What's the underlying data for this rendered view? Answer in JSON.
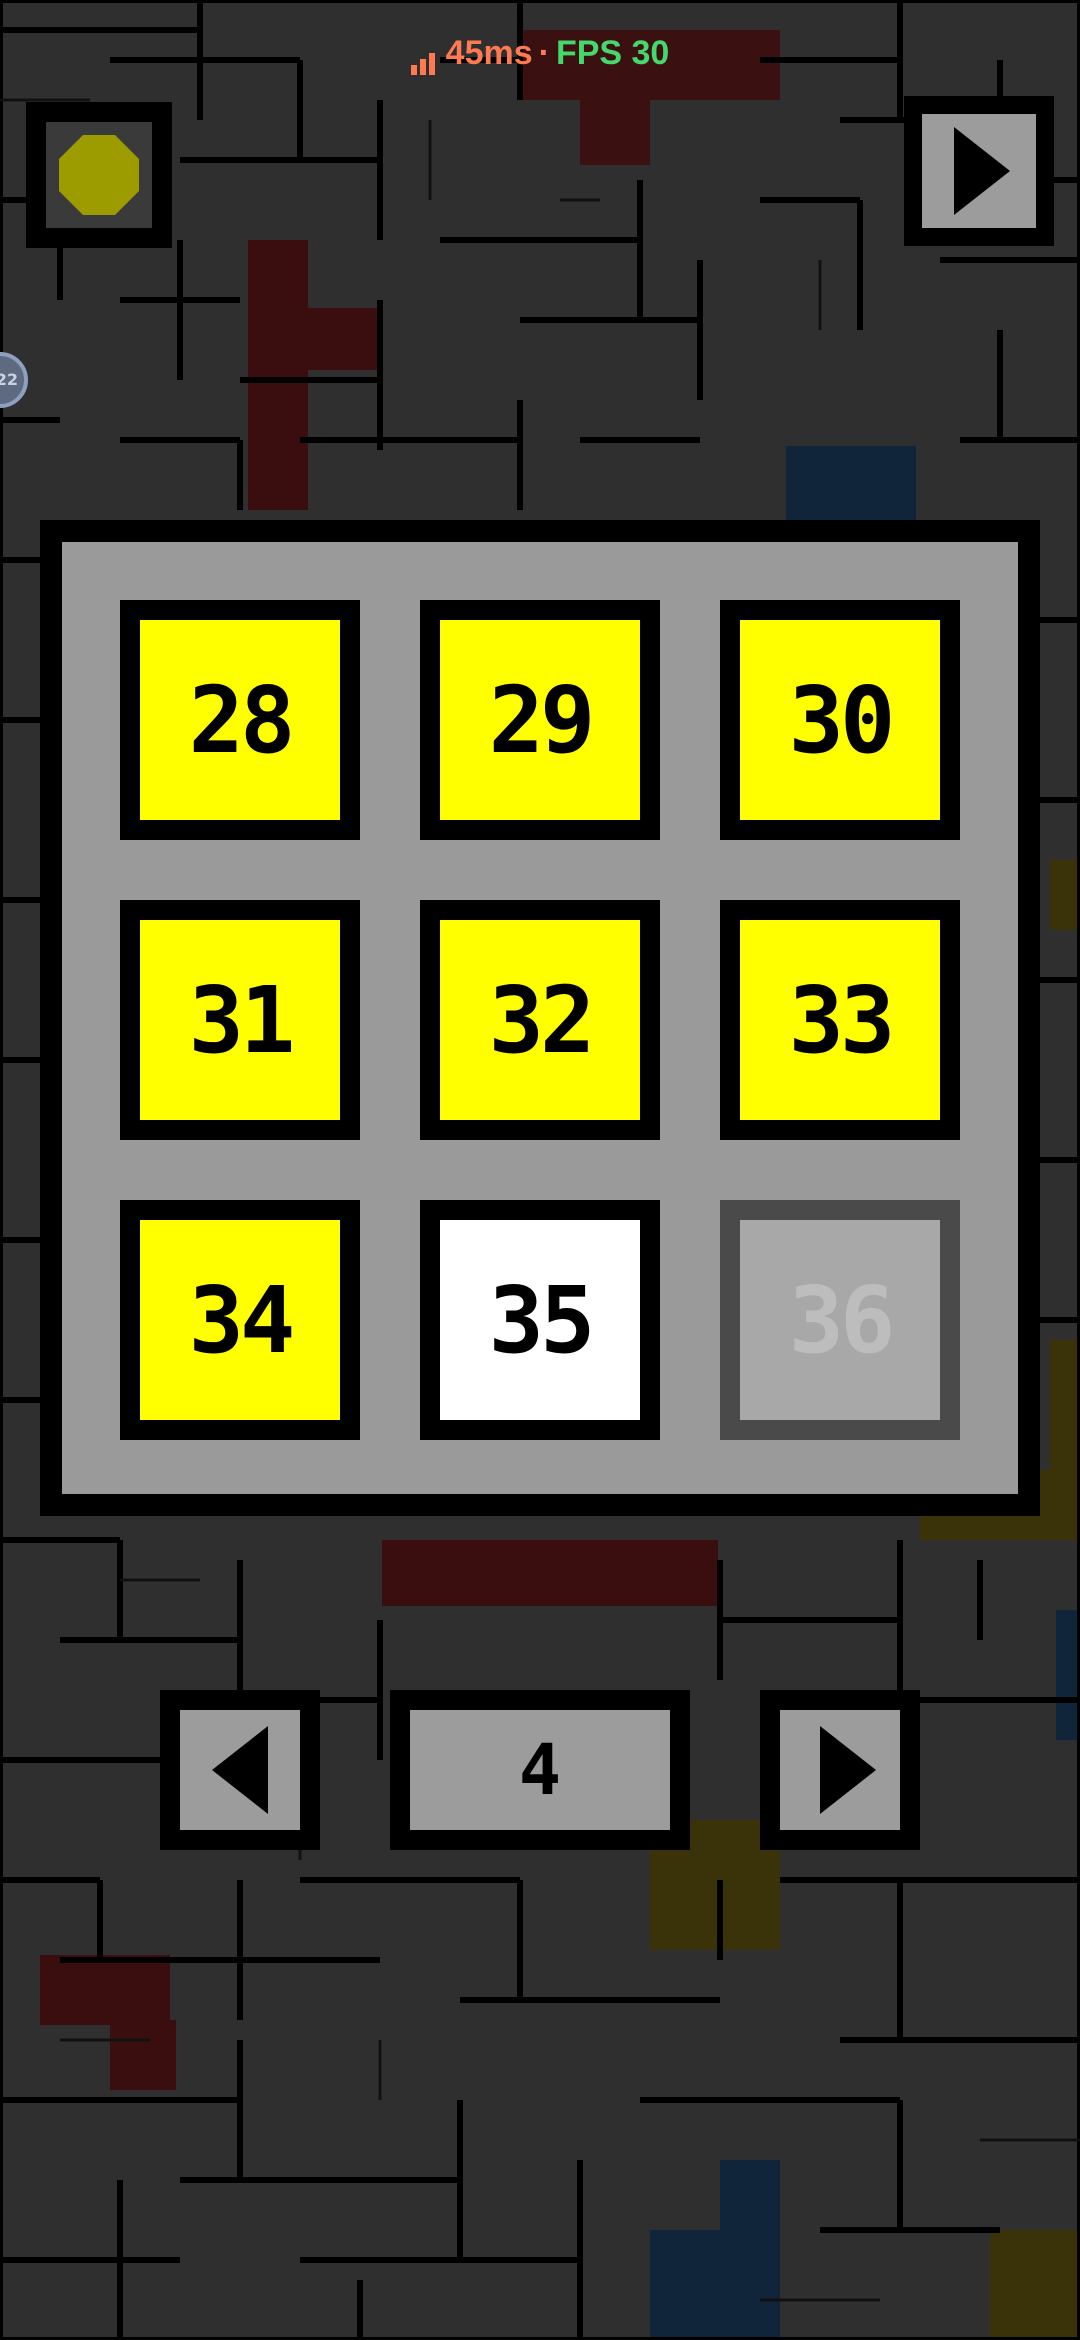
{
  "status_bar": {
    "ping": "45ms",
    "separator": "·",
    "fps": "FPS 30"
  },
  "side_badge": {
    "text": "22"
  },
  "levels": {
    "row1": [
      "28",
      "29",
      "30"
    ],
    "row2": [
      "31",
      "32",
      "33"
    ],
    "row3": [
      "34",
      "35",
      "36"
    ]
  },
  "pager": {
    "page": "4"
  },
  "colors": {
    "completed": "#ffff00",
    "current": "#ffffff",
    "locked": "#a8a8a8",
    "panel": "#9a9a9a",
    "ping": "#ff7a50",
    "fps": "#45d86b"
  }
}
